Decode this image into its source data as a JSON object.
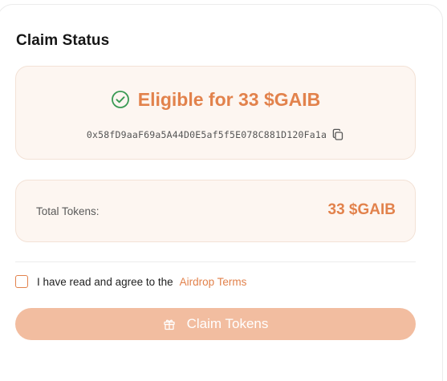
{
  "claim": {
    "title": "Claim Status",
    "eligibility_text": "Eligible for 33 $GAIB",
    "wallet_address": "0x58fD9aaF69a5A44D0E5af5f5E078C881D120Fa1a",
    "total_label": "Total Tokens:",
    "total_value": "33 $GAIB",
    "agree_text": "I have read and agree to the",
    "terms_link": "Airdrop Terms",
    "agreed": false,
    "button_label": "Claim Tokens",
    "button_enabled": false
  },
  "icons": {
    "eligibility": "check-circle-icon",
    "copy": "copy-icon",
    "claim": "gift-icon"
  },
  "colors": {
    "accent": "#e2824c",
    "success": "#3a9a54",
    "card_bg": "#fdf6f1",
    "button_disabled_bg": "#f2bda0"
  }
}
